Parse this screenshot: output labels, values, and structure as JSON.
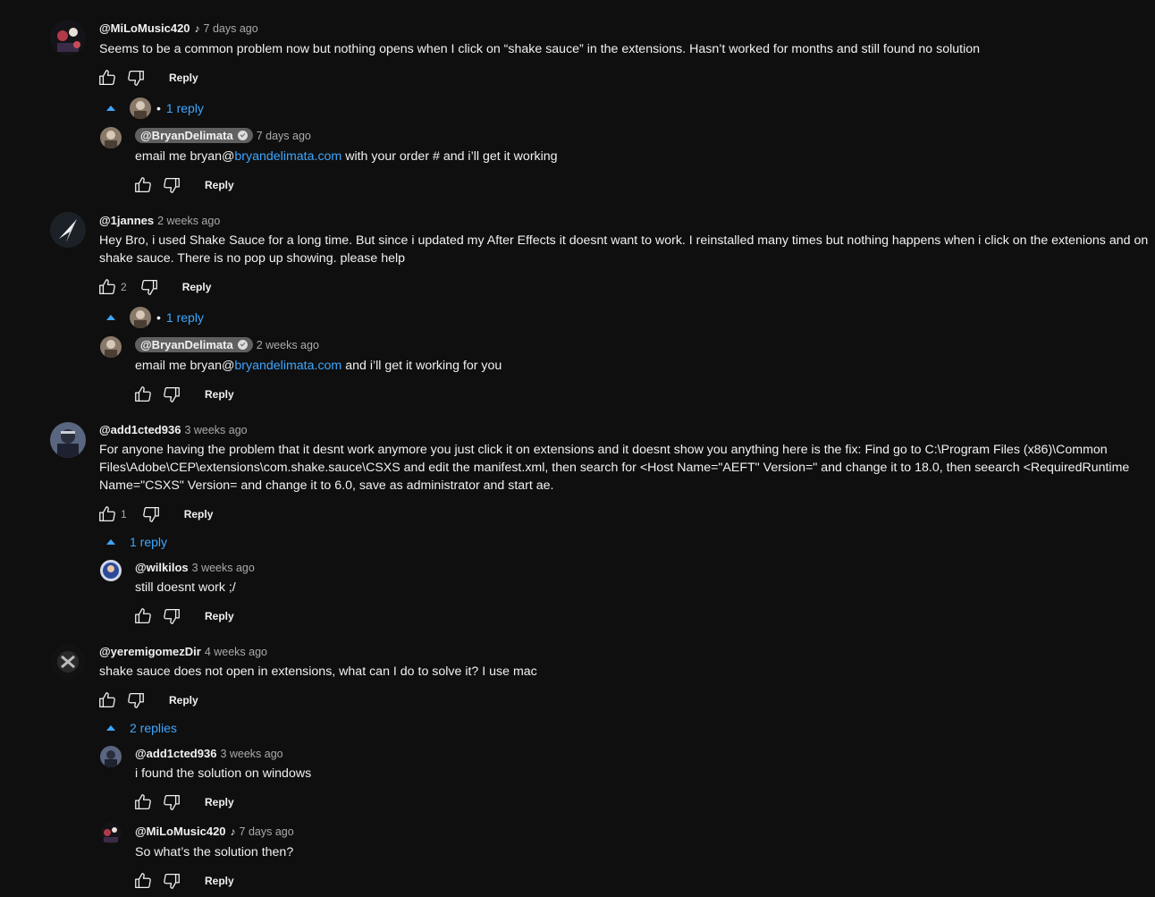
{
  "comments": [
    {
      "handle": "@MiLoMusic420",
      "music_note": "♪",
      "time": "7 days ago",
      "text": "Seems to be a common problem now but nothing opens when I click on “shake sauce” in the extensions. Hasn’t worked for months and still found no solution",
      "reply_label": "Reply",
      "replies_toggle": "1 reply",
      "replies": [
        {
          "handle": "@BryanDelimata",
          "time": "7 days ago",
          "text_before": "email me bryan@",
          "link": "bryandelimata.com",
          "text_after": " with your order # and i’ll get it working",
          "reply_label": "Reply"
        }
      ]
    },
    {
      "handle": "@1jannes",
      "time": "2 weeks ago",
      "text_line1": "Hey Bro, i used Shake Sauce for a long time. But since i updated my After Effects it doesnt want to work. I reinstalled many times but nothing happens when i click on the extenions and on",
      "text_line2": "shake sauce. There is no pop up showing. please help",
      "likes": "2",
      "reply_label": "Reply",
      "replies_toggle": "1 reply",
      "replies": [
        {
          "handle": "@BryanDelimata",
          "time": "2 weeks ago",
          "text_before": "email me bryan@",
          "link": "bryandelimata.com",
          "text_after": " and i’ll get it working for you",
          "reply_label": "Reply"
        }
      ]
    },
    {
      "handle": "@add1cted936",
      "time": "3 weeks ago",
      "text_line1": "For anyone having the problem that it desnt work anymore you just click it on extensions and it doesnt show you anything here is the fix: Find go to C:\\Program Files (x86)\\Common",
      "text_line2": "Files\\Adobe\\CEP\\extensions\\com.shake.sauce\\CSXS and edit the manifest.xml, then search for <Host Name=\"AEFT\" Version=\" and change it to 18.0, then seearch <RequiredRuntime",
      "text_line3": "Name=\"CSXS\" Version= and change it to 6.0, save as administrator and start ae.",
      "likes": "1",
      "reply_label": "Reply",
      "replies_toggle": "1 reply",
      "replies": [
        {
          "handle": "@wilkilos",
          "time": "3 weeks ago",
          "text": "still doesnt work ;/",
          "reply_label": "Reply"
        }
      ]
    },
    {
      "handle": "@yeremigomezDir",
      "time": "4 weeks ago",
      "text": "shake sauce does not open in extensions, what can I do to solve it? I use mac",
      "reply_label": "Reply",
      "replies_toggle": "2 replies",
      "replies": [
        {
          "handle": "@add1cted936",
          "time": "3 weeks ago",
          "text": "i found the solution on windows",
          "reply_label": "Reply"
        },
        {
          "handle": "@MiLoMusic420",
          "music_note": "♪",
          "time": "7 days ago",
          "text": "So what’s the solution then?",
          "reply_label": "Reply"
        }
      ]
    }
  ]
}
